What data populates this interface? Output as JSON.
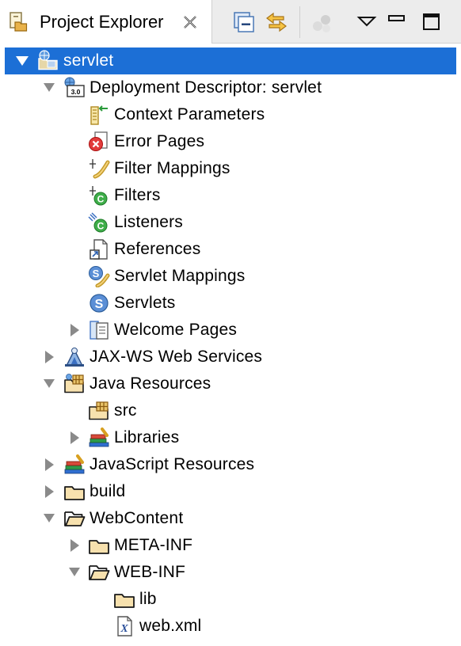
{
  "view": {
    "title": "Project Explorer",
    "toolbar": [
      "collapse-all",
      "link-with-editor",
      "focus-working-set",
      "view-menu",
      "minimize",
      "maximize"
    ]
  },
  "tree": [
    {
      "id": "servlet",
      "label": "servlet",
      "depth": 0,
      "expanded": true,
      "selected": true,
      "icon": "web-project-icon"
    },
    {
      "id": "dd",
      "label": "Deployment Descriptor: servlet",
      "depth": 1,
      "expanded": true,
      "icon": "deployment-descriptor-icon"
    },
    {
      "id": "ctx",
      "label": "Context Parameters",
      "depth": 2,
      "icon": "context-parameters-icon"
    },
    {
      "id": "err",
      "label": "Error Pages",
      "depth": 2,
      "icon": "error-pages-icon"
    },
    {
      "id": "fmap",
      "label": "Filter Mappings",
      "depth": 2,
      "icon": "filter-mappings-icon"
    },
    {
      "id": "filters",
      "label": "Filters",
      "depth": 2,
      "icon": "filters-icon"
    },
    {
      "id": "listeners",
      "label": "Listeners",
      "depth": 2,
      "icon": "listeners-icon"
    },
    {
      "id": "refs",
      "label": "References",
      "depth": 2,
      "icon": "references-icon"
    },
    {
      "id": "smap",
      "label": "Servlet Mappings",
      "depth": 2,
      "icon": "servlet-mappings-icon"
    },
    {
      "id": "servlets",
      "label": "Servlets",
      "depth": 2,
      "icon": "servlets-icon"
    },
    {
      "id": "welcome",
      "label": "Welcome Pages",
      "depth": 2,
      "expanded": false,
      "icon": "welcome-pages-icon"
    },
    {
      "id": "jaxws",
      "label": "JAX-WS Web Services",
      "depth": 1,
      "expanded": false,
      "icon": "jaxws-icon"
    },
    {
      "id": "javares",
      "label": "Java Resources",
      "depth": 1,
      "expanded": true,
      "icon": "java-resources-icon"
    },
    {
      "id": "src",
      "label": "src",
      "depth": 2,
      "icon": "source-folder-icon"
    },
    {
      "id": "libs",
      "label": "Libraries",
      "depth": 2,
      "expanded": false,
      "icon": "libraries-icon"
    },
    {
      "id": "jsres",
      "label": "JavaScript Resources",
      "depth": 1,
      "expanded": false,
      "icon": "libraries-icon"
    },
    {
      "id": "build",
      "label": "build",
      "depth": 1,
      "expanded": false,
      "icon": "folder-icon"
    },
    {
      "id": "webcontent",
      "label": "WebContent",
      "depth": 1,
      "expanded": true,
      "icon": "folder-open-icon"
    },
    {
      "id": "metainf",
      "label": "META-INF",
      "depth": 2,
      "expanded": false,
      "icon": "folder-icon"
    },
    {
      "id": "webinf",
      "label": "WEB-INF",
      "depth": 2,
      "expanded": true,
      "icon": "folder-open-icon"
    },
    {
      "id": "lib",
      "label": "lib",
      "depth": 3,
      "icon": "folder-icon"
    },
    {
      "id": "webxml",
      "label": "web.xml",
      "depth": 3,
      "icon": "xml-file-icon"
    }
  ]
}
